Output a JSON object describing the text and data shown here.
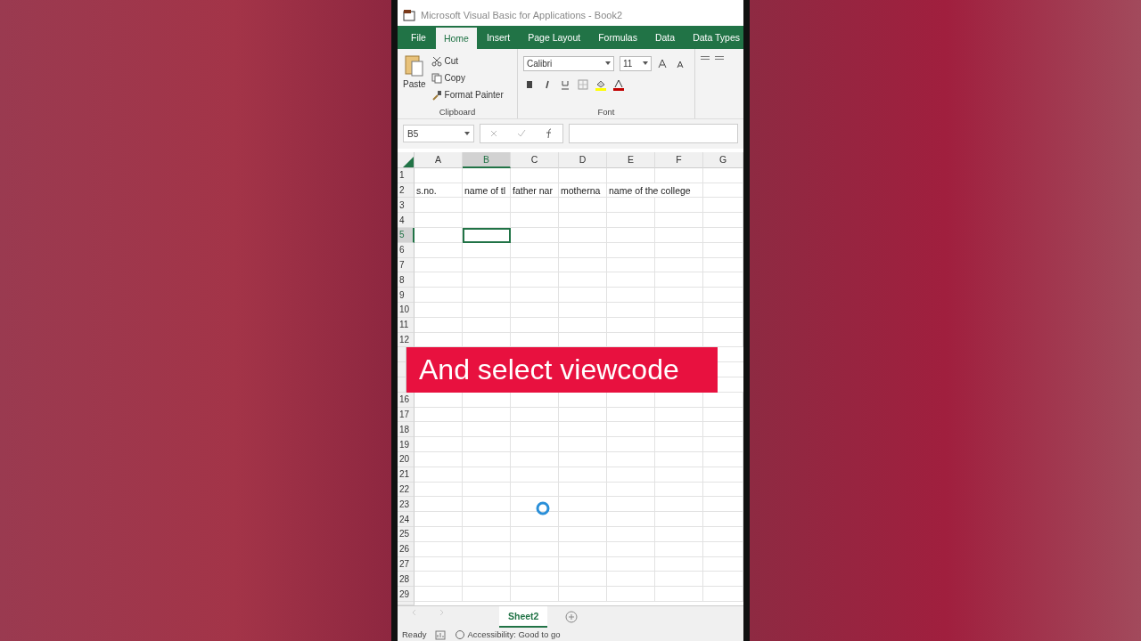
{
  "window": {
    "title": "Microsoft Visual Basic for Applications - Book2"
  },
  "tabs": [
    {
      "label": "File",
      "selected": false
    },
    {
      "label": "Home",
      "selected": true
    },
    {
      "label": "Insert",
      "selected": false
    },
    {
      "label": "Page Layout",
      "selected": false
    },
    {
      "label": "Formulas",
      "selected": false
    },
    {
      "label": "Data",
      "selected": false
    },
    {
      "label": "Data Types",
      "selected": false
    }
  ],
  "clipboard": {
    "paste": "Paste",
    "cut": "Cut",
    "copy": "Copy",
    "format_painter": "Format Painter",
    "label": "Clipboard"
  },
  "font": {
    "family": "Calibri",
    "size": "11",
    "label": "Font"
  },
  "name_box": "B5",
  "columns": [
    {
      "label": "A",
      "selected": false
    },
    {
      "label": "B",
      "selected": true
    },
    {
      "label": "C",
      "selected": false
    },
    {
      "label": "D",
      "selected": false
    },
    {
      "label": "E",
      "selected": false
    },
    {
      "label": "F",
      "selected": false
    },
    {
      "label": "G",
      "selected": false
    }
  ],
  "rows": [
    {
      "label": "1",
      "selected": false
    },
    {
      "label": "2",
      "selected": false,
      "cells": [
        "s.no.",
        "name of tl",
        "father nar",
        "motherna",
        "name of the college",
        null,
        null
      ]
    },
    {
      "label": "3",
      "selected": false
    },
    {
      "label": "4",
      "selected": false
    },
    {
      "label": "5",
      "selected": true
    },
    {
      "label": "6",
      "selected": false
    },
    {
      "label": "7",
      "selected": false
    },
    {
      "label": "8",
      "selected": false
    },
    {
      "label": "9",
      "selected": false
    },
    {
      "label": "10",
      "selected": false
    },
    {
      "label": "11",
      "selected": false
    },
    {
      "label": "12",
      "selected": false
    },
    {
      "kind": "caption",
      "text": "And select viewcode"
    },
    {
      "label": "16",
      "selected": false
    },
    {
      "label": "17",
      "selected": false
    },
    {
      "label": "18",
      "selected": false
    },
    {
      "label": "19",
      "selected": false
    },
    {
      "label": "20",
      "selected": false
    },
    {
      "label": "21",
      "selected": false
    },
    {
      "label": "22",
      "selected": false
    },
    {
      "label": "23",
      "selected": false
    },
    {
      "label": "24",
      "selected": false
    },
    {
      "label": "25",
      "selected": false
    },
    {
      "label": "26",
      "selected": false
    },
    {
      "label": "27",
      "selected": false
    },
    {
      "label": "28",
      "selected": false
    },
    {
      "label": "29",
      "selected": false
    }
  ],
  "sheet_tabs": [
    {
      "label": "Sheet2",
      "selected": true
    }
  ],
  "status_bar": {
    "mode": "Ready",
    "accessibility": "Accessibility: Good to go"
  }
}
